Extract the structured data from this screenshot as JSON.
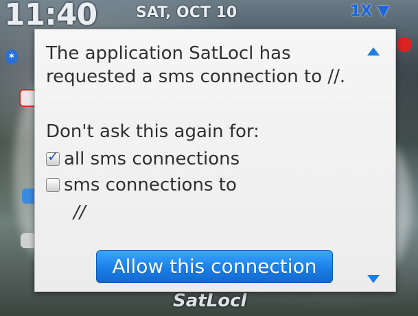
{
  "status_bar": {
    "time": "11:40",
    "date": "SAT, OCT 10",
    "network": "1X"
  },
  "home": {
    "app_label": "SatLocl"
  },
  "dialog": {
    "message": "The application SatLocl has requested a sms connection to //.",
    "ask_label": "Don't ask this again for:",
    "option1": {
      "label": "all sms connections",
      "checked": true
    },
    "option2": {
      "label": "sms connections to",
      "checked": false
    },
    "option2_target": "//",
    "allow_button": "Allow this connection"
  },
  "colors": {
    "accent": "#1a7fe6",
    "dialog_bg": "#f0f0f0"
  },
  "icons": {
    "bluetooth": "bluetooth-icon",
    "signal": "signal-icon",
    "scroll_up": "scroll-up-icon",
    "scroll_down": "scroll-down-icon",
    "checkbox_checked": "checkbox-checked-icon",
    "checkbox_unchecked": "checkbox-unchecked-icon"
  }
}
